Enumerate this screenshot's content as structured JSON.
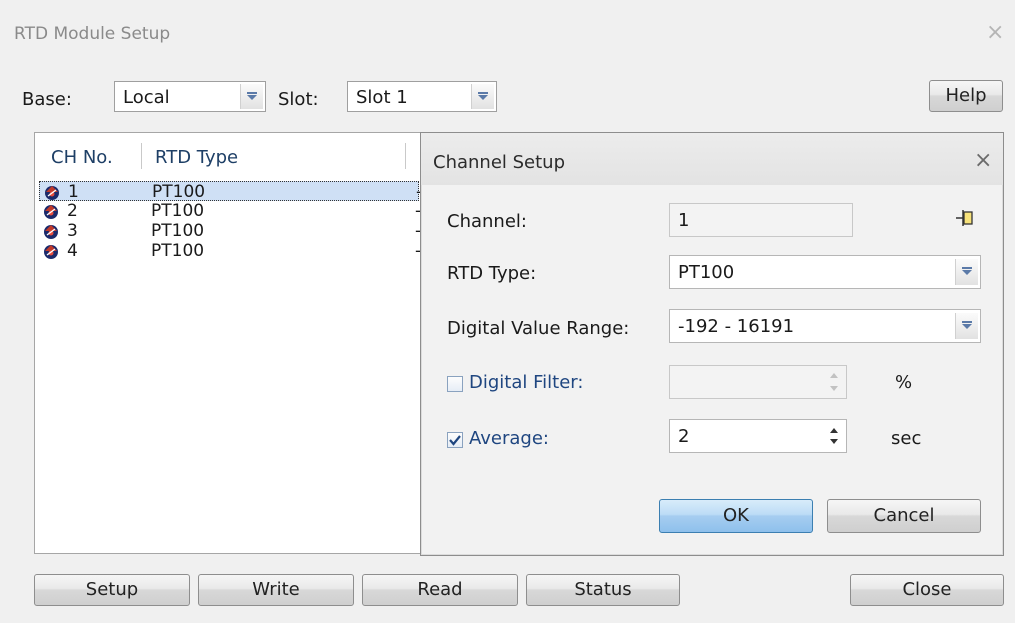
{
  "main_window": {
    "title": "RTD Module Setup",
    "close_glyph": "×",
    "base_label": "Base:",
    "base_value": "Local",
    "slot_label": "Slot:",
    "slot_value": "Slot 1",
    "help_label": "Help"
  },
  "channel_list": {
    "headers": [
      "CH No.",
      "RTD Type"
    ],
    "rows": [
      {
        "num": "1",
        "type": "PT100",
        "extra": "-",
        "icon": "channel-icon",
        "selected": true
      },
      {
        "num": "2",
        "type": "PT100",
        "extra": "-",
        "icon": "channel-icon",
        "selected": false
      },
      {
        "num": "3",
        "type": "PT100",
        "extra": "-",
        "icon": "channel-icon",
        "selected": false
      },
      {
        "num": "4",
        "type": "PT100",
        "extra": "-",
        "icon": "channel-icon",
        "selected": false
      }
    ]
  },
  "bottom_buttons": {
    "setup": "Setup",
    "write": "Write",
    "read": "Read",
    "status": "Status",
    "close": "Close"
  },
  "channel_setup": {
    "title": "Channel Setup",
    "close_glyph": "×",
    "channel_label": "Channel:",
    "channel_value": "1",
    "rtd_type_label": "RTD Type:",
    "rtd_type_value": "PT100",
    "range_label": "Digital Value Range:",
    "range_value": "-192 - 16191",
    "digital_filter_label": "Digital Filter:",
    "digital_filter_checked": false,
    "digital_filter_value": "",
    "digital_filter_unit": "%",
    "average_label": "Average:",
    "average_checked": true,
    "average_value": "2",
    "average_unit": "sec",
    "ok_label": "OK",
    "cancel_label": "Cancel"
  },
  "icons": {
    "pin": "pin-icon",
    "dropdown": "chevron-down-icon",
    "spinner": "spinner-arrows-icon",
    "checkmark": "checkmark-icon"
  },
  "colors": {
    "selection": "#cfe0f5",
    "ok_button": "#a6cdf0",
    "blue_label": "#1f4680"
  }
}
